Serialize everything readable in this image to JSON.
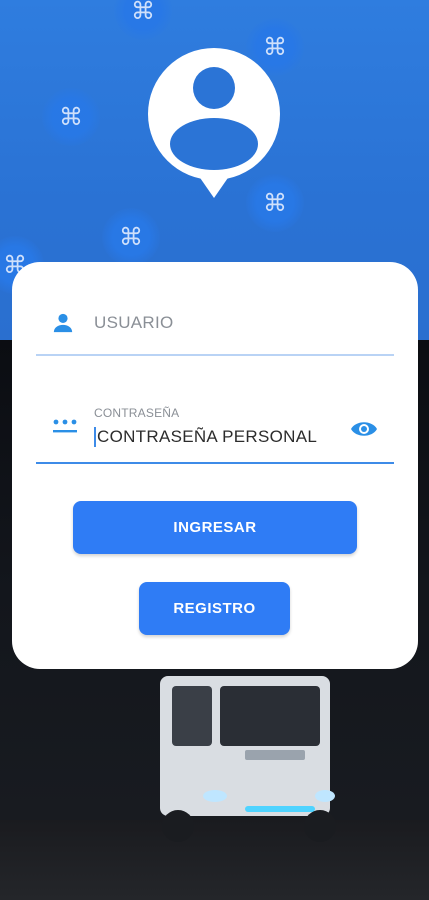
{
  "login": {
    "username_placeholder": "USUARIO",
    "password_label": "CONTRASEÑA",
    "password_value": "CONTRASEÑA PERSONAL",
    "login_button": "INGRESAR",
    "register_button": "REGISTRO"
  },
  "icons": {
    "background_pattern": "command-icon",
    "avatar": "user-avatar-pin-icon",
    "username": "person-icon",
    "password": "password-dots-icon",
    "toggle_visibility": "eye-icon"
  },
  "colors": {
    "primary": "#2f7cf5",
    "header_blue": "#2f7ddf",
    "field_underline_active": "#3d8be8",
    "field_underline": "#b9d3f5",
    "icon_blue": "#2a8fe6"
  }
}
